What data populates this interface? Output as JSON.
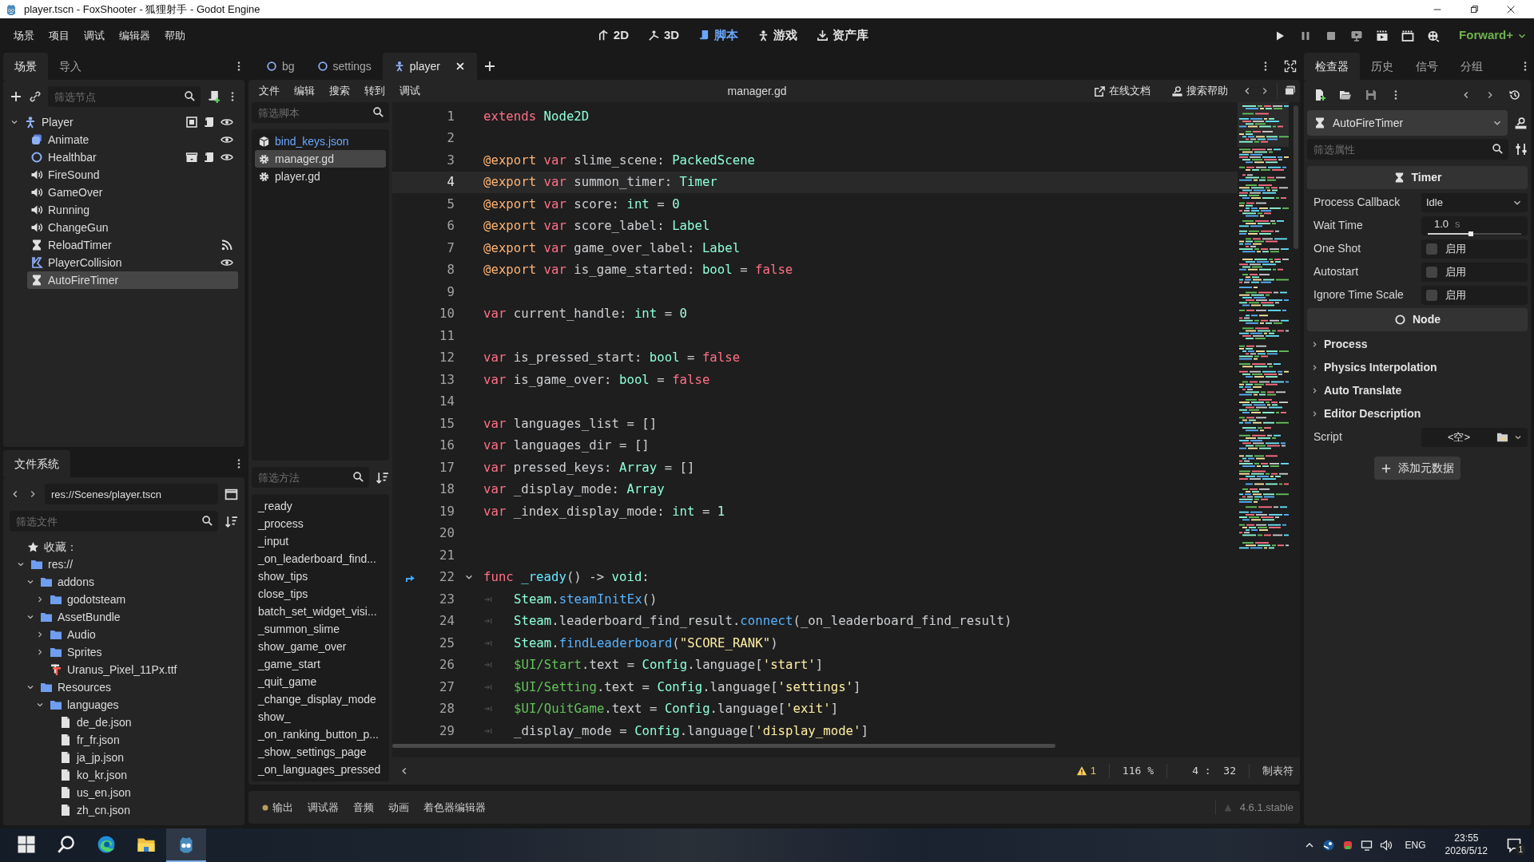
{
  "window": {
    "title": "player.tscn - FoxShooter - 狐狸射手 - Godot Engine"
  },
  "menu": [
    "场景",
    "项目",
    "调试",
    "编辑器",
    "帮助"
  ],
  "workspaces": [
    {
      "label": "2D",
      "kind": "plane",
      "selected": false
    },
    {
      "label": "3D",
      "kind": "space",
      "selected": false
    },
    {
      "label": "脚本",
      "kind": "script",
      "selected": true
    },
    {
      "label": "游戏",
      "kind": "game",
      "selected": false
    },
    {
      "label": "资产库",
      "kind": "assetlib",
      "selected": false
    }
  ],
  "renderer": "Forward+",
  "scene_dock": {
    "tabs": [
      {
        "label": "场景",
        "selected": true
      },
      {
        "label": "导入",
        "selected": false
      }
    ],
    "filter": {
      "placeholder": "筛选节点"
    },
    "tree": [
      {
        "label": "Player",
        "kind": "player",
        "expanded": true,
        "selected": false,
        "badges": [
          {
            "kind": "screen"
          },
          {
            "kind": "script"
          },
          {
            "kind": "eye"
          }
        ],
        "children": [
          {
            "label": "Animate",
            "kind": "sprite",
            "selected": false,
            "badges": [
              {
                "kind": "eye"
              }
            ]
          },
          {
            "label": "Healthbar",
            "kind": "circle",
            "selected": false,
            "badges": [
              {
                "kind": "scene"
              },
              {
                "kind": "script"
              },
              {
                "kind": "eye"
              }
            ]
          },
          {
            "label": "FireSound",
            "kind": "audio",
            "selected": false
          },
          {
            "label": "GameOver",
            "kind": "audio",
            "selected": false
          },
          {
            "label": "Running",
            "kind": "audio",
            "selected": false
          },
          {
            "label": "ChangeGun",
            "kind": "audio",
            "selected": false
          },
          {
            "label": "ReloadTimer",
            "kind": "timer",
            "selected": false,
            "badges": [
              {
                "kind": "signal"
              }
            ]
          },
          {
            "label": "PlayerCollision",
            "kind": "collision",
            "selected": false,
            "badges": [
              {
                "kind": "eye"
              }
            ]
          },
          {
            "label": "AutoFireTimer",
            "kind": "timer",
            "selected": true
          }
        ]
      }
    ]
  },
  "filesystem": {
    "tab": "文件系统",
    "path": "res://Scenes/player.tscn",
    "filter": {
      "placeholder": "筛选文件"
    },
    "favorites": "收藏：",
    "tree": [
      {
        "label": "res://",
        "kind": "folder",
        "expanded": true,
        "children": [
          {
            "label": "addons",
            "kind": "folder",
            "expanded": true,
            "children": [
              {
                "label": "godotsteam",
                "kind": "folder",
                "expanded": false
              }
            ]
          },
          {
            "label": "AssetBundle",
            "kind": "folder",
            "expanded": true,
            "children": [
              {
                "label": "Audio",
                "kind": "folder",
                "expanded": false
              },
              {
                "label": "Sprites",
                "kind": "folder",
                "expanded": false
              },
              {
                "label": "Uranus_Pixel_11Px.ttf",
                "kind": "font"
              }
            ]
          },
          {
            "label": "Resources",
            "kind": "folder",
            "expanded": true,
            "children": [
              {
                "label": "languages",
                "kind": "folder",
                "expanded": true,
                "children": [
                  {
                    "label": "de_de.json",
                    "kind": "file"
                  },
                  {
                    "label": "fr_fr.json",
                    "kind": "file"
                  },
                  {
                    "label": "ja_jp.json",
                    "kind": "file"
                  },
                  {
                    "label": "ko_kr.json",
                    "kind": "file"
                  },
                  {
                    "label": "us_en.json",
                    "kind": "file"
                  },
                  {
                    "label": "zh_cn.json",
                    "kind": "file"
                  }
                ]
              }
            ]
          }
        ]
      }
    ]
  },
  "editor_tabs": [
    {
      "label": "bg",
      "kind": "circle",
      "selected": false
    },
    {
      "label": "settings",
      "kind": "circle",
      "selected": false
    },
    {
      "label": "player",
      "kind": "player",
      "selected": true
    }
  ],
  "script_menu": [
    "文件",
    "编辑",
    "搜索",
    "转到",
    "调试"
  ],
  "script_name": "manager.gd",
  "help_buttons": [
    {
      "label": "在线文档",
      "kind": "external"
    },
    {
      "label": "搜索帮助",
      "kind": "doc"
    }
  ],
  "scripts": {
    "filter": {
      "placeholder": "筛选脚本"
    },
    "items": [
      {
        "label": "bind_keys.json",
        "kind": "json",
        "selected": false
      },
      {
        "label": "manager.gd",
        "kind": "gd",
        "selected": true
      },
      {
        "label": "player.gd",
        "kind": "gd",
        "selected": false
      }
    ]
  },
  "methods": {
    "filter": {
      "placeholder": "筛选方法"
    },
    "items": [
      "_ready",
      "_process",
      "_input",
      "_on_leaderboard_find...",
      "show_tips",
      "close_tips",
      "batch_set_widget_visi...",
      "_summon_slime",
      "show_game_over",
      "_game_start",
      "_quit_game",
      "_change_display_mode",
      "show_",
      "_on_ranking_button_p...",
      "_show_settings_page",
      "_on_languages_pressed"
    ]
  },
  "code": [
    {
      "n": "1",
      "current": false,
      "tab": false,
      "tokens": [
        {
          "kind": "kw",
          "text": "extends "
        },
        {
          "kind": "type",
          "text": "Node2D"
        }
      ]
    },
    {
      "n": "2",
      "current": false,
      "tab": false
    },
    {
      "n": "3",
      "current": false,
      "tab": false,
      "tokens": [
        {
          "kind": "ann",
          "text": "@export "
        },
        {
          "kind": "kw",
          "text": "var"
        },
        {
          "kind": "p",
          "text": " slime_scene: "
        },
        {
          "kind": "type",
          "text": "PackedScene"
        }
      ]
    },
    {
      "n": "4",
      "current": true,
      "tab": false,
      "tokens": [
        {
          "kind": "ann",
          "text": "@export "
        },
        {
          "kind": "kw",
          "text": "var"
        },
        {
          "kind": "p",
          "text": " summon_timer: "
        },
        {
          "kind": "type",
          "text": "Timer"
        }
      ]
    },
    {
      "n": "5",
      "current": false,
      "tab": false,
      "tokens": [
        {
          "kind": "ann",
          "text": "@export "
        },
        {
          "kind": "kw",
          "text": "var"
        },
        {
          "kind": "p",
          "text": " score: "
        },
        {
          "kind": "type",
          "text": "int"
        },
        {
          "kind": "p",
          "text": " = "
        },
        {
          "kind": "num",
          "text": "0"
        }
      ]
    },
    {
      "n": "6",
      "current": false,
      "tab": false,
      "tokens": [
        {
          "kind": "ann",
          "text": "@export "
        },
        {
          "kind": "kw",
          "text": "var"
        },
        {
          "kind": "p",
          "text": " score_label: "
        },
        {
          "kind": "type",
          "text": "Label"
        }
      ]
    },
    {
      "n": "7",
      "current": false,
      "tab": false,
      "tokens": [
        {
          "kind": "ann",
          "text": "@export "
        },
        {
          "kind": "kw",
          "text": "var"
        },
        {
          "kind": "p",
          "text": " game_over_label: "
        },
        {
          "kind": "type",
          "text": "Label"
        }
      ]
    },
    {
      "n": "8",
      "current": false,
      "tab": false,
      "tokens": [
        {
          "kind": "ann",
          "text": "@export "
        },
        {
          "kind": "kw",
          "text": "var"
        },
        {
          "kind": "p",
          "text": " is_game_started: "
        },
        {
          "kind": "type",
          "text": "bool"
        },
        {
          "kind": "p",
          "text": " = "
        },
        {
          "kind": "kw",
          "text": "false"
        }
      ]
    },
    {
      "n": "9",
      "current": false,
      "tab": false
    },
    {
      "n": "10",
      "current": false,
      "tab": false,
      "tokens": [
        {
          "kind": "kw",
          "text": "var"
        },
        {
          "kind": "p",
          "text": " current_handle: "
        },
        {
          "kind": "type",
          "text": "int"
        },
        {
          "kind": "p",
          "text": " = "
        },
        {
          "kind": "num",
          "text": "0"
        }
      ]
    },
    {
      "n": "11",
      "current": false,
      "tab": false
    },
    {
      "n": "12",
      "current": false,
      "tab": false,
      "tokens": [
        {
          "kind": "kw",
          "text": "var"
        },
        {
          "kind": "p",
          "text": " is_pressed_start: "
        },
        {
          "kind": "type",
          "text": "bool"
        },
        {
          "kind": "p",
          "text": " = "
        },
        {
          "kind": "kw",
          "text": "false"
        }
      ]
    },
    {
      "n": "13",
      "current": false,
      "tab": false,
      "tokens": [
        {
          "kind": "kw",
          "text": "var"
        },
        {
          "kind": "p",
          "text": " is_game_over: "
        },
        {
          "kind": "type",
          "text": "bool"
        },
        {
          "kind": "p",
          "text": " = "
        },
        {
          "kind": "kw",
          "text": "false"
        }
      ]
    },
    {
      "n": "14",
      "current": false,
      "tab": false
    },
    {
      "n": "15",
      "current": false,
      "tab": false,
      "tokens": [
        {
          "kind": "kw",
          "text": "var"
        },
        {
          "kind": "p",
          "text": " languages_list = []"
        }
      ]
    },
    {
      "n": "16",
      "current": false,
      "tab": false,
      "tokens": [
        {
          "kind": "kw",
          "text": "var"
        },
        {
          "kind": "p",
          "text": " languages_dir = []"
        }
      ]
    },
    {
      "n": "17",
      "current": false,
      "tab": false,
      "tokens": [
        {
          "kind": "kw",
          "text": "var"
        },
        {
          "kind": "p",
          "text": " pressed_keys: "
        },
        {
          "kind": "type",
          "text": "Array"
        },
        {
          "kind": "p",
          "text": " = []"
        }
      ]
    },
    {
      "n": "18",
      "current": false,
      "tab": false,
      "tokens": [
        {
          "kind": "kw",
          "text": "var"
        },
        {
          "kind": "p",
          "text": " _display_mode: "
        },
        {
          "kind": "type",
          "text": "Array"
        }
      ]
    },
    {
      "n": "19",
      "current": false,
      "tab": false,
      "tokens": [
        {
          "kind": "kw",
          "text": "var"
        },
        {
          "kind": "p",
          "text": " _index_display_mode: "
        },
        {
          "kind": "type",
          "text": "int"
        },
        {
          "kind": "p",
          "text": " = "
        },
        {
          "kind": "num",
          "text": "1"
        }
      ]
    },
    {
      "n": "20",
      "current": false,
      "tab": false
    },
    {
      "n": "21",
      "current": false,
      "tab": false
    },
    {
      "n": "22",
      "current": false,
      "tab": false,
      "fold": true,
      "marker": true,
      "tokens": [
        {
          "kind": "kw",
          "text": "func "
        },
        {
          "kind": "decl",
          "text": "_ready"
        },
        {
          "kind": "p",
          "text": "() -> "
        },
        {
          "kind": "type",
          "text": "void"
        },
        {
          "kind": "p",
          "text": ":"
        }
      ]
    },
    {
      "n": "23",
      "current": false,
      "tab": true,
      "tokens": [
        {
          "kind": "type",
          "text": "Steam"
        },
        {
          "kind": "p",
          "text": "."
        },
        {
          "kind": "call",
          "text": "steamInitEx"
        },
        {
          "kind": "p",
          "text": "()"
        }
      ]
    },
    {
      "n": "24",
      "current": false,
      "tab": true,
      "tokens": [
        {
          "kind": "type",
          "text": "Steam"
        },
        {
          "kind": "p",
          "text": ".leaderboard_find_result."
        },
        {
          "kind": "call",
          "text": "connect"
        },
        {
          "kind": "p",
          "text": "(_on_leaderboard_find_result)"
        }
      ]
    },
    {
      "n": "25",
      "current": false,
      "tab": true,
      "tokens": [
        {
          "kind": "type",
          "text": "Steam"
        },
        {
          "kind": "p",
          "text": "."
        },
        {
          "kind": "call",
          "text": "findLeaderboard"
        },
        {
          "kind": "p",
          "text": "("
        },
        {
          "kind": "str",
          "text": "\"SCORE_RANK\""
        },
        {
          "kind": "p",
          "text": ")"
        }
      ]
    },
    {
      "n": "26",
      "current": false,
      "tab": true,
      "tokens": [
        {
          "kind": "path",
          "text": "$UI/Start"
        },
        {
          "kind": "p",
          "text": ".text = "
        },
        {
          "kind": "type",
          "text": "Config"
        },
        {
          "kind": "p",
          "text": ".language["
        },
        {
          "kind": "str",
          "text": "'start'"
        },
        {
          "kind": "p",
          "text": "]"
        }
      ]
    },
    {
      "n": "27",
      "current": false,
      "tab": true,
      "tokens": [
        {
          "kind": "path",
          "text": "$UI/Setting"
        },
        {
          "kind": "p",
          "text": ".text = "
        },
        {
          "kind": "type",
          "text": "Config"
        },
        {
          "kind": "p",
          "text": ".language["
        },
        {
          "kind": "str",
          "text": "'settings'"
        },
        {
          "kind": "p",
          "text": "]"
        }
      ]
    },
    {
      "n": "28",
      "current": false,
      "tab": true,
      "tokens": [
        {
          "kind": "path",
          "text": "$UI/QuitGame"
        },
        {
          "kind": "p",
          "text": ".text = "
        },
        {
          "kind": "type",
          "text": "Config"
        },
        {
          "kind": "p",
          "text": ".language["
        },
        {
          "kind": "str",
          "text": "'exit'"
        },
        {
          "kind": "p",
          "text": "]"
        }
      ]
    },
    {
      "n": "29",
      "current": false,
      "tab": true,
      "tokens": [
        {
          "kind": "p",
          "text": "_display_mode = "
        },
        {
          "kind": "type",
          "text": "Config"
        },
        {
          "kind": "p",
          "text": ".language["
        },
        {
          "kind": "str",
          "text": "'display_mode'"
        },
        {
          "kind": "p",
          "text": "]"
        }
      ]
    }
  ],
  "status": {
    "warnings": "1",
    "zoom": "116 %",
    "position": "4 :  32",
    "indent": "制表符"
  },
  "bottom_tabs": [
    {
      "label": "输出",
      "dot": true,
      "selected": false
    },
    {
      "label": "调试器",
      "dot": false,
      "selected": false
    },
    {
      "label": "音频",
      "dot": false,
      "selected": false
    },
    {
      "label": "动画",
      "dot": false,
      "selected": false
    },
    {
      "label": "着色器编辑器",
      "dot": false,
      "selected": false
    }
  ],
  "version": "4.6.1.stable",
  "inspector": {
    "tabs": [
      {
        "label": "检查器",
        "selected": true
      },
      {
        "label": "历史",
        "selected": false
      },
      {
        "label": "信号",
        "selected": false
      },
      {
        "label": "分组",
        "selected": false
      }
    ],
    "object": "AutoFireTimer",
    "filter": {
      "placeholder": "筛选属性"
    },
    "sections": [
      {
        "kind": "header",
        "label": "Timer"
      },
      {
        "kind": "dropdown",
        "label": "Process Callback",
        "value": "Idle"
      },
      {
        "kind": "slider",
        "label": "Wait Time",
        "value": "1.0",
        "unit": "s",
        "level": 0.46
      },
      {
        "kind": "check",
        "label": "One Shot",
        "text": "启用",
        "checked": false
      },
      {
        "kind": "check",
        "label": "Autostart",
        "text": "启用",
        "checked": false
      },
      {
        "kind": "check",
        "label": "Ignore Time Scale",
        "text": "启用",
        "checked": false
      },
      {
        "kind": "header",
        "label": "Node"
      },
      {
        "kind": "group",
        "label": "Process"
      },
      {
        "kind": "group",
        "label": "Physics Interpolation"
      },
      {
        "kind": "group",
        "label": "Auto Translate"
      },
      {
        "kind": "group",
        "label": "Editor Description"
      },
      {
        "kind": "resource",
        "label": "Script",
        "value": "<空>"
      }
    ],
    "add_button": "添加元数据"
  },
  "taskbar": {
    "apps": [
      {
        "kind": "start",
        "selected": false
      },
      {
        "kind": "search",
        "selected": false
      },
      {
        "kind": "edge",
        "selected": false
      },
      {
        "kind": "explorer",
        "selected": false
      },
      {
        "kind": "godot",
        "selected": true
      }
    ],
    "language": "ENG",
    "time": "23:55",
    "date": "2026/5/12",
    "notifications": "1"
  }
}
